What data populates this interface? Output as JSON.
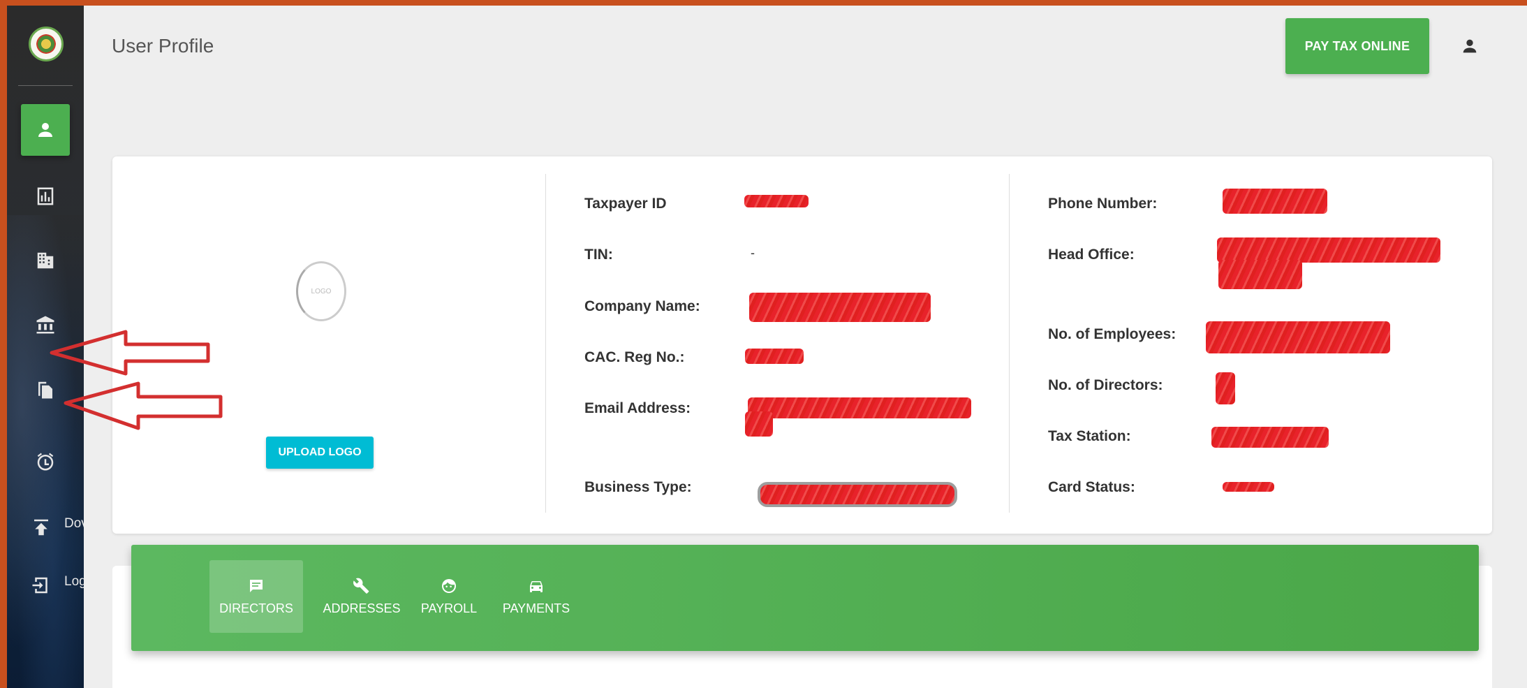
{
  "header": {
    "title": "User Profile",
    "pay_button": "PAY TAX ONLINE"
  },
  "sidebar": {
    "items": [
      {
        "icon": "person-icon",
        "active": true
      },
      {
        "icon": "bar-chart-icon"
      },
      {
        "icon": "building-icon"
      },
      {
        "icon": "bank-icon"
      },
      {
        "icon": "copy-file-icon"
      },
      {
        "icon": "alarm-clock-icon"
      },
      {
        "icon": "upload-icon",
        "label": "Dov"
      },
      {
        "icon": "logout-icon",
        "label": "Log"
      }
    ]
  },
  "profile": {
    "logo_placeholder": "LOGO",
    "upload_button": "UPLOAD LOGO",
    "fields_left": [
      {
        "label": "Taxpayer ID",
        "value": ""
      },
      {
        "label": "TIN:",
        "value": "-"
      },
      {
        "label": "Company Name:",
        "value": ""
      },
      {
        "label": "CAC. Reg No.:",
        "value": ""
      },
      {
        "label": "Email Address:",
        "value": ""
      },
      {
        "label": "Business Type:",
        "value": ""
      }
    ],
    "fields_right": [
      {
        "label": "Phone Number:",
        "value": ""
      },
      {
        "label": "Head Office:",
        "value": ""
      },
      {
        "label": "No. of Employees:",
        "value": ""
      },
      {
        "label": "No. of Directors:",
        "value": ""
      },
      {
        "label": "Tax Station:",
        "value": ""
      },
      {
        "label": "Card Status:",
        "value": ""
      }
    ]
  },
  "tabs": [
    {
      "label": "DIRECTORS",
      "icon": "chat-icon",
      "active": true
    },
    {
      "label": "ADDRESSES",
      "icon": "wrench-icon"
    },
    {
      "label": "PAYROLL",
      "icon": "face-icon"
    },
    {
      "label": "PAYMENTS",
      "icon": "car-icon"
    }
  ],
  "colors": {
    "accent": "#4caf50",
    "upload": "#00bcd4",
    "redaction": "#e8222a",
    "annotation": "#d32f2f"
  }
}
